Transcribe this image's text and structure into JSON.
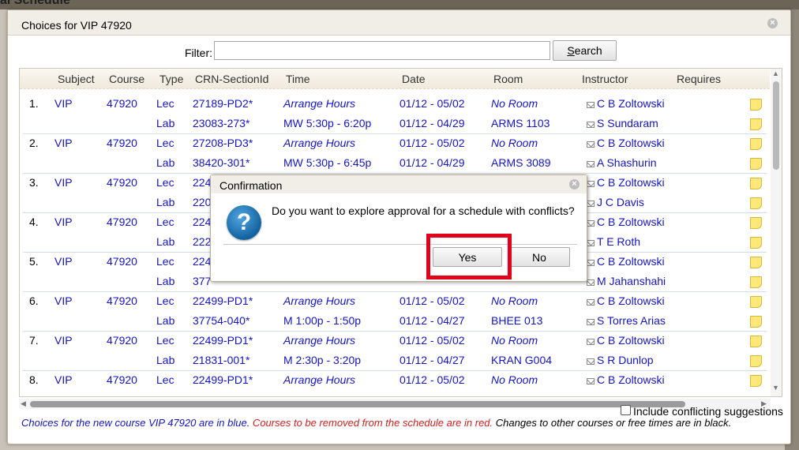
{
  "background": {
    "title": "al Schedule"
  },
  "dialog": {
    "title": "Choices for VIP 47920",
    "filter_label": "Filter:",
    "filter_value": "",
    "search_label": "Search",
    "search_underline": "S",
    "search_rest": "earch"
  },
  "table": {
    "headers": [
      "Subject",
      "Course",
      "Type",
      "CRN-SectionId",
      "Time",
      "Date",
      "Room",
      "Instructor",
      "Requires"
    ],
    "rows": [
      {
        "num": "1.",
        "subject": "VIP",
        "course": "47920",
        "type": "Lec",
        "crn": "27189-PD2*",
        "time": "Arrange Hours",
        "date": "01/12 - 05/02",
        "room": "No Room",
        "instructor": "C B Zoltowski"
      },
      {
        "num": "",
        "subject": "",
        "course": "",
        "type": "Lab",
        "crn": "23083-273*",
        "time": "MW 5:30p - 6:20p",
        "date": "01/12 - 04/29",
        "room": "ARMS 1103",
        "instructor": "S Sundaram"
      },
      {
        "num": "2.",
        "subject": "VIP",
        "course": "47920",
        "type": "Lec",
        "crn": "27208-PD3*",
        "time": "Arrange Hours",
        "date": "01/12 - 05/02",
        "room": "No Room",
        "instructor": "C B Zoltowski"
      },
      {
        "num": "",
        "subject": "",
        "course": "",
        "type": "Lab",
        "crn": "38420-301*",
        "time": "MW 5:30p - 6:45p",
        "date": "01/12 - 04/29",
        "room": "ARMS 3089",
        "instructor": "A Shashurin"
      },
      {
        "num": "3.",
        "subject": "VIP",
        "course": "47920",
        "type": "Lec",
        "crn": "224",
        "time": "",
        "date": "",
        "room": "",
        "instructor": "C B Zoltowski"
      },
      {
        "num": "",
        "subject": "",
        "course": "",
        "type": "Lab",
        "crn": "220",
        "time": "",
        "date": "",
        "room": "",
        "instructor": "J C Davis"
      },
      {
        "num": "4.",
        "subject": "VIP",
        "course": "47920",
        "type": "Lec",
        "crn": "224",
        "time": "",
        "date": "",
        "room": "",
        "instructor": "C B Zoltowski"
      },
      {
        "num": "",
        "subject": "",
        "course": "",
        "type": "Lab",
        "crn": "222",
        "time": "",
        "date": "",
        "room": "",
        "instructor": "T E Roth"
      },
      {
        "num": "5.",
        "subject": "VIP",
        "course": "47920",
        "type": "Lec",
        "crn": "224",
        "time": "",
        "date": "",
        "room": "",
        "instructor": "C B Zoltowski"
      },
      {
        "num": "",
        "subject": "",
        "course": "",
        "type": "Lab",
        "crn": "377",
        "time": "",
        "date": "",
        "room": "",
        "instructor": "M Jahanshahi"
      },
      {
        "num": "6.",
        "subject": "VIP",
        "course": "47920",
        "type": "Lec",
        "crn": "22499-PD1*",
        "time": "Arrange Hours",
        "date": "01/12 - 05/02",
        "room": "No Room",
        "instructor": "C B Zoltowski"
      },
      {
        "num": "",
        "subject": "",
        "course": "",
        "type": "Lab",
        "crn": "37754-040*",
        "time": "M 1:00p - 1:50p",
        "date": "01/12 - 04/27",
        "room": "BHEE 013",
        "instructor": "S Torres Arias"
      },
      {
        "num": "7.",
        "subject": "VIP",
        "course": "47920",
        "type": "Lec",
        "crn": "22499-PD1*",
        "time": "Arrange Hours",
        "date": "01/12 - 05/02",
        "room": "No Room",
        "instructor": "C B Zoltowski"
      },
      {
        "num": "",
        "subject": "",
        "course": "",
        "type": "Lab",
        "crn": "21831-001*",
        "time": "M 2:30p - 3:20p",
        "date": "01/12 - 04/27",
        "room": "KRAN G004",
        "instructor": "S R Dunlop"
      },
      {
        "num": "8.",
        "subject": "VIP",
        "course": "47920",
        "type": "Lec",
        "crn": "22499-PD1*",
        "time": "Arrange Hours",
        "date": "01/12 - 05/02",
        "room": "No Room",
        "instructor": "C B Zoltowski"
      }
    ]
  },
  "footer": {
    "checkbox_label": "Include conflicting suggestions",
    "legend_blue": "Choices for the new course VIP 47920 are in blue.",
    "legend_red": "Courses to be removed from the schedule are in red.",
    "legend_black": "Changes to other courses or free times are in black."
  },
  "confirmation": {
    "title": "Confirmation",
    "message": "Do you want to explore approval for a schedule with conflicts?",
    "yes_label": "Yes",
    "no_label": "No",
    "icon_glyph": "?"
  },
  "colors": {
    "choice_blue": "#1414c8",
    "remove_red": "#d81c1c",
    "highlight_red": "#e3001b"
  }
}
